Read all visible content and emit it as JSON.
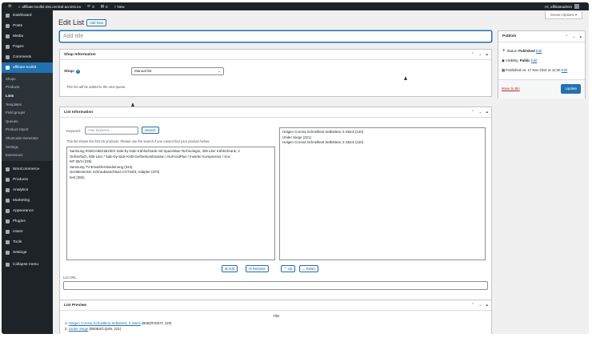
{
  "admin_bar": {
    "site": "affiliate-toolkit-dev.central-access.eu",
    "updates": "3",
    "comments": "0",
    "new": "+ New",
    "greeting": "Hi, affiliateadmin"
  },
  "sidebar": {
    "items_top": [
      {
        "label": "Dashboard",
        "icon": "dashboard-icon"
      },
      {
        "label": "Posts",
        "icon": "pin-icon"
      },
      {
        "label": "Media",
        "icon": "media-icon"
      },
      {
        "label": "Pages",
        "icon": "page-icon"
      },
      {
        "label": "Comments",
        "icon": "comment-icon"
      }
    ],
    "active": {
      "label": "affiliate-toolkit",
      "icon": "toolkit-icon"
    },
    "submenu": [
      "Shops",
      "Products",
      "Lists",
      "Templates",
      "Field groups",
      "Queues",
      "Product import",
      "Shortcode Generator",
      "Settings",
      "Extensions"
    ],
    "items_bottom": [
      {
        "label": "WooCommerce",
        "icon": "woo-icon"
      },
      {
        "label": "Products",
        "icon": "products-icon"
      },
      {
        "label": "Analytics",
        "icon": "analytics-icon"
      },
      {
        "label": "Marketing",
        "icon": "megaphone-icon"
      },
      {
        "label": "Appearance",
        "icon": "brush-icon"
      },
      {
        "label": "Plugins",
        "icon": "plugin-icon"
      },
      {
        "label": "Users",
        "icon": "users-icon"
      },
      {
        "label": "Tools",
        "icon": "wrench-icon"
      },
      {
        "label": "Settings",
        "icon": "settings-icon"
      },
      {
        "label": "Collapse menu",
        "icon": "collapse-icon"
      }
    ]
  },
  "header": {
    "title": "Edit List",
    "add_new": "Add New",
    "screen_options": "Screen Options ▾",
    "title_placeholder": "Add title"
  },
  "shop_info": {
    "title": "Shop Information",
    "shop_label": "Shop:",
    "shop_value": "Manual list",
    "note": "This list will be added to the next queue."
  },
  "list_info": {
    "title": "List Information",
    "keyword_label": "Keyword:",
    "keyword_placeholder": "Your keyword...",
    "search_button": "Search",
    "hint": "This list shows the first 25 products. Please use the search if you cannot find your product below.",
    "results": [
      "Samsung RS6GA8521B1/EG Side-by-Side Kühlschrank mit SpaceMax-Technologie, 409 Liter Kühlschrank, 2",
      "Gefrierfach, 609 Liter / Side-by-Side Kühl-Gefrierkombination / NoFrostPlus / Inverter Kompressor / Koc",
      "MT 65/3 (339)",
      "Samsung TV-Ersatzfernbedienung (344)",
      "Gerätestecker Schraubanschluss CST18/3, Adapter (370)",
      "test (382)"
    ],
    "selected": [
      "Holgen Corona Schnelltest Selbsttest, 5 Stück (120)",
      "Under Siege (221)",
      "Holgen Corona Schnelltest Selbsttest, 5 Stück (120)"
    ],
    "add_button": "⊕ Add",
    "remove_button": "⊖ Remove",
    "up_button": "⌃ Up",
    "down_button": "⌄ Down",
    "list_url_label": "List URL:"
  },
  "list_preview": {
    "title": "List Preview",
    "column": "Title",
    "rows": [
      {
        "num": "1.",
        "link": "Holgen Corona Schnelltest Selbsttest, 5 Stück",
        "meta": "(B08Z/FZ0HT, 120)"
      },
      {
        "num": "2.",
        "link": "Under Siege",
        "meta": "(B00B2/CQXN, 221)"
      }
    ]
  },
  "publish": {
    "title": "Publish",
    "status_label": "Status:",
    "status_value": "Published",
    "status_edit": "Edit",
    "visibility_label": "Visibility:",
    "visibility_value": "Public",
    "visibility_edit": "Edit",
    "published_text": "Published on: 17 Nov 2021 at 12:36",
    "published_edit": "Edit",
    "trash": "Move to Bin",
    "update": "Update"
  },
  "colors": {
    "accent": "#2271b1",
    "admin_bg": "#1d2327",
    "trash": "#b32d2e"
  }
}
